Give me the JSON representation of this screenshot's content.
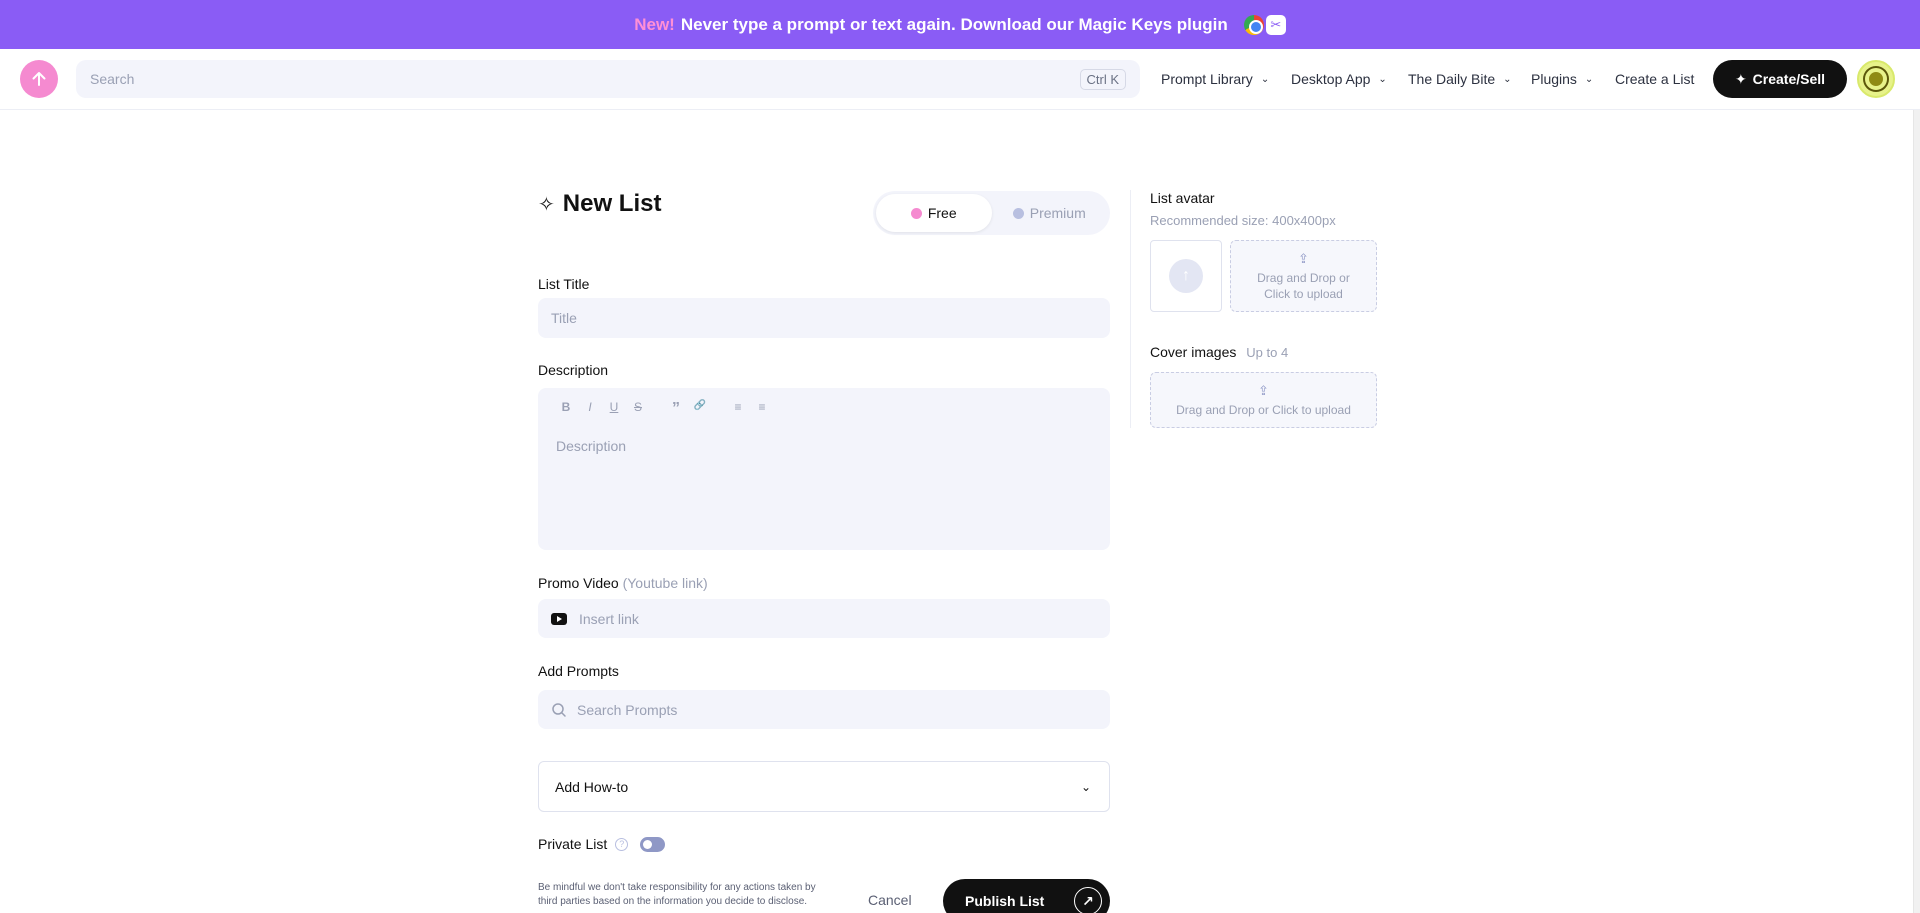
{
  "banner": {
    "new_label": "New!",
    "text": "Never type a prompt or text again. Download our Magic Keys plugin"
  },
  "header": {
    "search_placeholder": "Search",
    "search_shortcut": "Ctrl K",
    "nav": [
      {
        "label": "Prompt Library"
      },
      {
        "label": "Desktop App"
      },
      {
        "label": "The Daily Bite"
      },
      {
        "label": "Plugins"
      },
      {
        "label": "Create a List"
      }
    ],
    "create_button": "Create/Sell"
  },
  "form": {
    "title": "New List",
    "toggle": {
      "free": "Free",
      "premium": "Premium"
    },
    "list_title_label": "List Title",
    "list_title_placeholder": "Title",
    "description_label": "Description",
    "description_placeholder": "Description",
    "toolbar": [
      "B",
      "I",
      "U",
      "S",
      "”",
      "🔗",
      "≡",
      "≡"
    ],
    "promo_label": "Promo Video",
    "promo_hint": "(Youtube link)",
    "promo_placeholder": "Insert link",
    "prompts_label": "Add Prompts",
    "prompts_placeholder": "Search Prompts",
    "howto_label": "Add How-to",
    "private_label": "Private List",
    "disclaimer": "Be mindful we don't take responsibility for any actions taken by third parties based on the information you decide to disclose.",
    "cancel": "Cancel",
    "publish": "Publish List"
  },
  "sidebar": {
    "avatar_label": "List avatar",
    "avatar_hint": "Recommended size: 400x400px",
    "avatar_upload_line1": "Drag and Drop or",
    "avatar_upload_line2": "Click to upload",
    "cover_label": "Cover images",
    "cover_hint": "Up to 4",
    "cover_upload": "Drag and Drop or Click to upload"
  },
  "colors": {
    "banner": "#8a5cf5",
    "accent_pink": "#f58ad0",
    "field_bg": "#f3f4fb"
  }
}
